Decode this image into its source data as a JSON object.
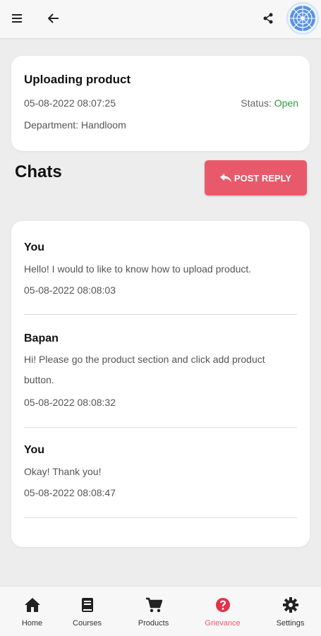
{
  "colors": {
    "accent": "#e85a6b",
    "status_open": "#2e9b3a",
    "background": "#ededed"
  },
  "header": {
    "menu_icon": "hamburger-menu-icon",
    "back_icon": "arrow-left-icon",
    "share_icon": "share-icon",
    "avatar_icon": "mandala-logo"
  },
  "ticket": {
    "title": "Uploading product",
    "date": "05-08-2022 08:07:25",
    "status_label": "Status:",
    "status_value": "Open",
    "department": "Department: Handloom"
  },
  "chats": {
    "heading": "Chats",
    "post_reply_label": "POST REPLY",
    "post_reply_icon": "reply-icon",
    "messages": [
      {
        "sender": "You",
        "text": "Hello! I would to like to know how to upload product.",
        "time": "05-08-2022 08:08:03"
      },
      {
        "sender": "Bapan",
        "text": "Hi! Please go the product section and click add product button.",
        "time": "05-08-2022 08:08:32"
      },
      {
        "sender": "You",
        "text": "Okay! Thank you!",
        "time": "05-08-2022 08:08:47"
      }
    ]
  },
  "bottom_nav": {
    "items": [
      {
        "label": "Home",
        "icon": "home-icon"
      },
      {
        "label": "Courses",
        "icon": "book-icon"
      },
      {
        "label": "Products",
        "icon": "cart-icon"
      },
      {
        "label": "Grievance",
        "icon": "help-circle-icon",
        "active": true
      },
      {
        "label": "Settings",
        "icon": "gear-icon"
      }
    ]
  }
}
